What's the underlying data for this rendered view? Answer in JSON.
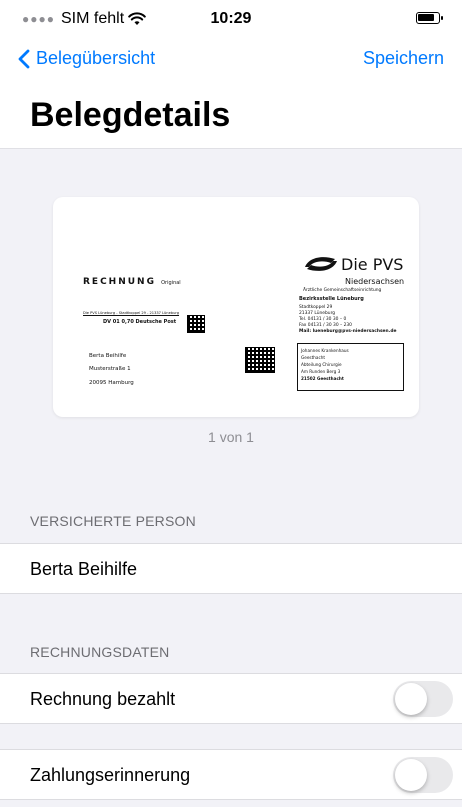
{
  "status_bar": {
    "carrier": "SIM fehlt",
    "time": "10:29"
  },
  "nav": {
    "back_label": "Belegübersicht",
    "save_label": "Speichern"
  },
  "page": {
    "title": "Belegdetails"
  },
  "document": {
    "page_indicator": "1 von 1",
    "content": {
      "heading": "RECHNUNG",
      "heading_note": "Original",
      "logo_text": "Die PVS",
      "logo_subtitle": "Niedersachsen",
      "logo_tagline": "Ärztliche Gemeinschaftseinrichtung",
      "office_name": "Bezirksstelle Lüneburg",
      "office_lines": [
        "Stadtkoppel 29",
        "21337 Lüneburg",
        "Tel. 04131 / 30 30 – 0",
        "Fax 04131 / 30 30 – 230",
        "Mail: lueneburg@pvs-niedersachsen.de"
      ],
      "sender_line": "Die PVS Lüneburg - Stadtkoppel 29 - 21337 Lüneburg",
      "postage_line": "DV 01 0,70 Deutsche Post",
      "recipient_lines": [
        "Berta Beihilfe",
        "Musterstraße 1",
        "20095 Hamburg"
      ],
      "clinic_lines": [
        "Johannes Krankenhaus",
        "Geesthacht",
        "Abteilung Chirurgie",
        "Am Runden Berg 3",
        "21502 Geesthacht"
      ]
    }
  },
  "insured_section": {
    "header": "VERSICHERTE PERSON",
    "name": "Berta Beihilfe"
  },
  "invoice_section": {
    "header": "RECHNUNGSDATEN",
    "paid_label": "Rechnung bezahlt",
    "paid_on": false,
    "reminder_label": "Zahlungserinnerung",
    "reminder_on": false
  }
}
